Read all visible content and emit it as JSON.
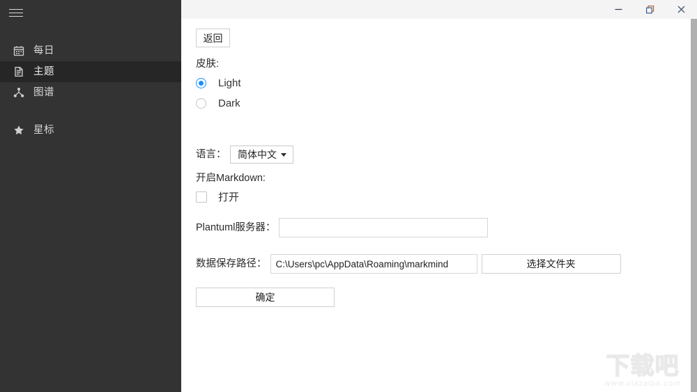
{
  "window": {
    "controls": [
      {
        "name": "minimize",
        "icon": "minimize-icon",
        "label": "—"
      },
      {
        "name": "restore",
        "icon": "restore-icon",
        "label": "❐"
      },
      {
        "name": "close",
        "icon": "close-icon",
        "label": "✕"
      }
    ]
  },
  "sidebar": {
    "menu_icon": "hamburger-icon",
    "items": [
      {
        "label": "每日",
        "icon": "calendar-icon",
        "selected": false
      },
      {
        "label": "主题",
        "icon": "document-icon",
        "selected": true
      },
      {
        "label": "图谱",
        "icon": "graph-icon",
        "selected": false
      },
      {
        "label": "星标",
        "icon": "star-icon",
        "selected": false
      }
    ]
  },
  "settings": {
    "back_button": "返回",
    "skin": {
      "label": "皮肤:",
      "options": [
        {
          "label": "Light",
          "checked": true
        },
        {
          "label": "Dark",
          "checked": false
        }
      ]
    },
    "language": {
      "label": "语言：",
      "selected": "简体中文",
      "options": [
        "简体中文"
      ]
    },
    "markdown": {
      "label": "开启Markdown:",
      "checkbox_label": "打开",
      "checked": false
    },
    "plantuml": {
      "label": "Plantuml服务器：",
      "value": "",
      "placeholder": ""
    },
    "data_path": {
      "label": "数据保存路径：",
      "value": "C:\\Users\\pc\\AppData\\Roaming\\markmind",
      "placeholder": "",
      "browse_button": "选择文件夹"
    },
    "confirm_button": "确定"
  },
  "watermark": {
    "title": "下载吧",
    "url": "www.xiazaiba.com"
  },
  "colors": {
    "sidebar_bg": "#333333",
    "sidebar_selected_bg": "#262626",
    "titlebar_bg": "#f4f4f4",
    "accent": "#1890ff",
    "scrollbar": "#b0b0b0"
  }
}
